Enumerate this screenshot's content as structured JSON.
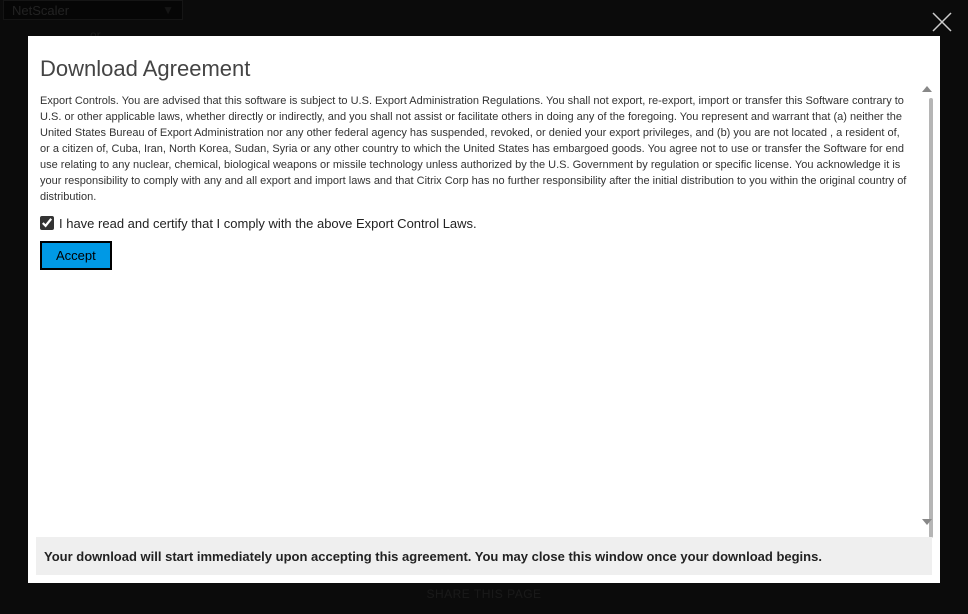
{
  "background": {
    "select_value": "NetScaler",
    "or_text": "or",
    "share_label": "SHARE THIS PAGE"
  },
  "modal": {
    "title": "Download Agreement",
    "body": "Export Controls. You are advised that this software is subject to U.S. Export Administration Regulations. You shall not export, re-export, import or transfer this Software contrary to U.S. or other applicable laws, whether directly or indirectly, and you shall not assist or facilitate others in doing any of the foregoing. You represent and warrant that (a) neither the United States Bureau of Export Administration nor any other federal agency has suspended, revoked, or denied your export privileges, and (b) you are not located , a resident of, or a citizen of, Cuba, Iran, North Korea, Sudan, Syria or any other country to which the United States has embargoed goods. You agree not to use or transfer the Software for end use relating to any nuclear, chemical, biological weapons or missile technology unless authorized by the U.S. Government by regulation or specific license. You acknowledge it is your responsibility to comply with any and all export and import laws and that Citrix Corp has no further responsibility after the initial distribution to you within the original country of distribution.",
    "checkbox_label": "I have read and certify that I comply with the above Export Control Laws.",
    "accept_label": "Accept",
    "footer_text": "Your download will start immediately upon accepting this agreement. You may close this window once your download begins."
  }
}
